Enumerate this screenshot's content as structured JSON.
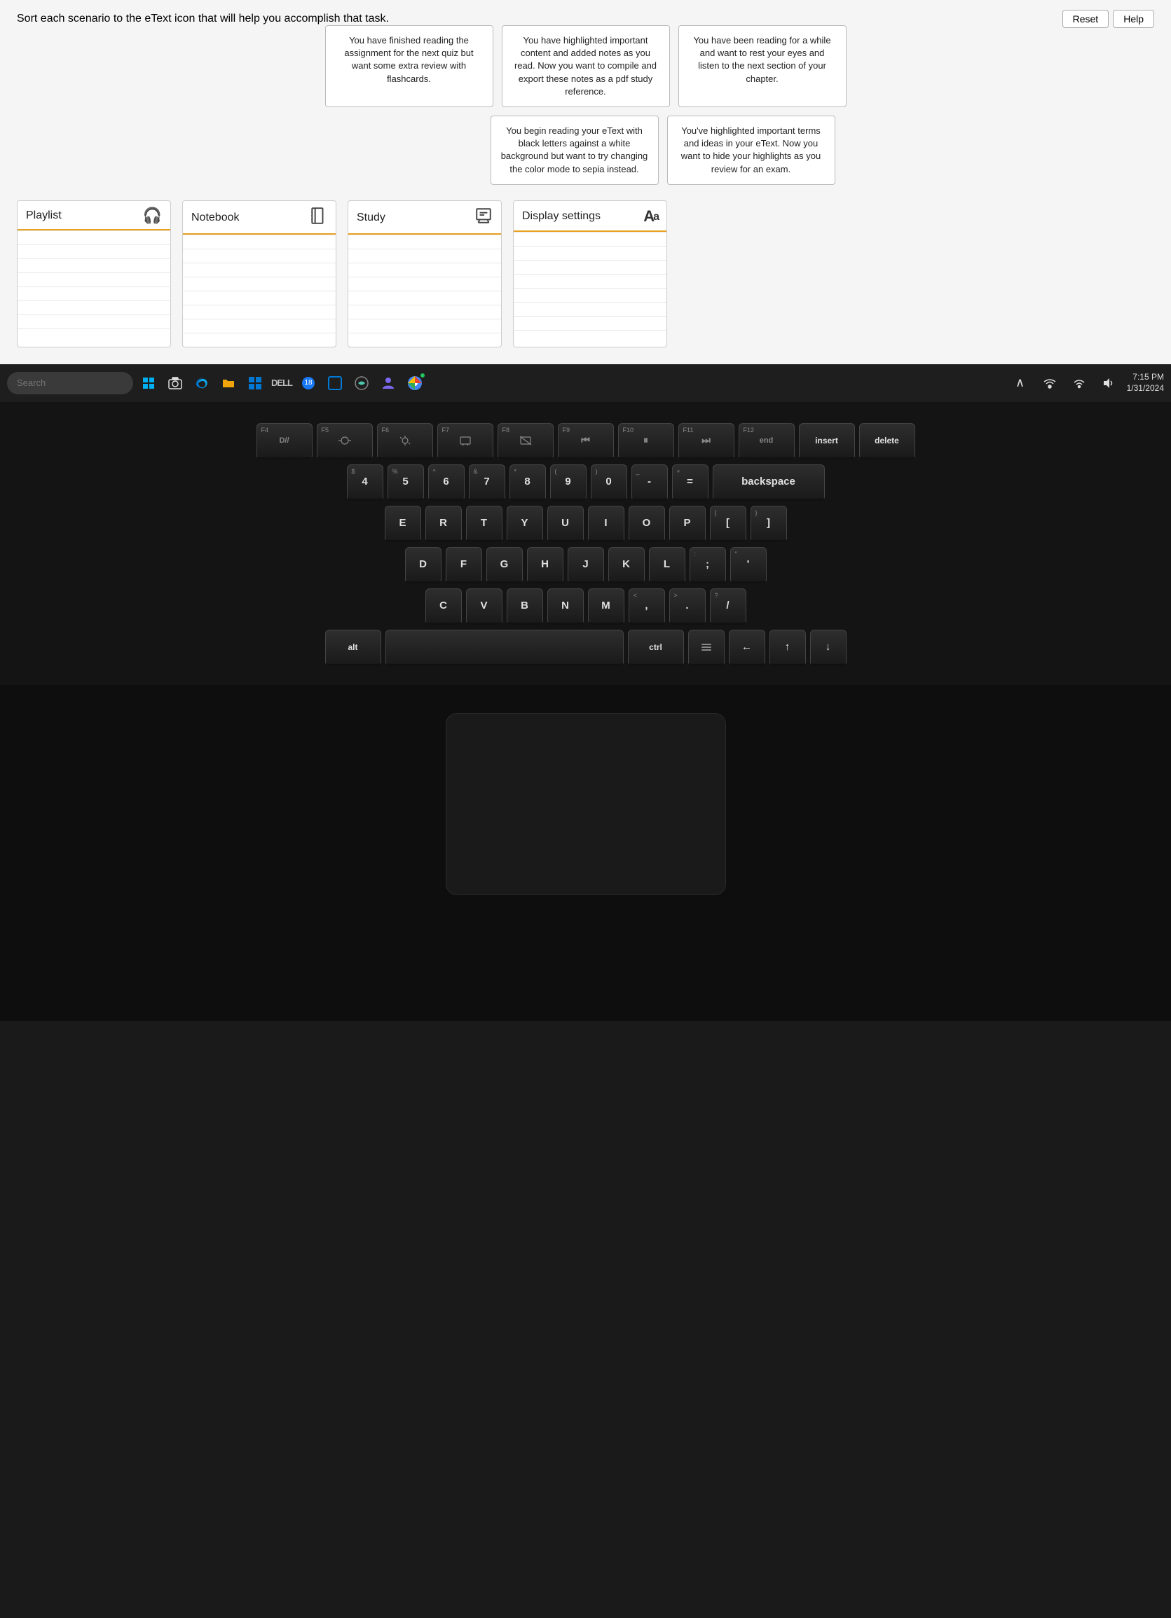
{
  "instruction": "Sort each scenario to the eText icon that will help you accomplish that task.",
  "buttons": {
    "reset": "Reset",
    "help": "Help"
  },
  "scenarios": {
    "row1": [
      {
        "id": "s1",
        "text": "You have finished reading the assignment for the next quiz but want some extra review with flashcards."
      },
      {
        "id": "s2",
        "text": "You have highlighted important content and added notes as you read. Now you want to compile and export these notes as a pdf study reference."
      },
      {
        "id": "s3",
        "text": "You have been reading for a while and want to rest your eyes and listen to the next section of your chapter."
      }
    ],
    "row2": [
      {
        "id": "s4",
        "text": "You begin reading your eText with black letters against a white background but want to try changing the color mode to sepia instead."
      },
      {
        "id": "s5",
        "text": "You've highlighted important terms and ideas in your eText. Now you want to hide your highlights as you review for an exam."
      }
    ]
  },
  "drop_zones": [
    {
      "id": "dz1",
      "label": "Playlist",
      "icon": "headphones"
    },
    {
      "id": "dz2",
      "label": "Notebook",
      "icon": "notebook"
    },
    {
      "id": "dz3",
      "label": "Study",
      "icon": "study"
    },
    {
      "id": "dz4",
      "label": "Display settings",
      "icon": "aa"
    }
  ],
  "taskbar": {
    "search_placeholder": "Search",
    "time": "7:15 PM",
    "date": "1/31/2024",
    "notification_count": "18"
  },
  "keyboard": {
    "fn_row": [
      "F4",
      "F5",
      "F6",
      "F7",
      "F8",
      "F9",
      "F10",
      "F11",
      "F12",
      "insert",
      "delete"
    ],
    "num_row": [
      "4",
      "5",
      "6",
      "7",
      "8",
      "9",
      "0",
      "-",
      "="
    ],
    "row1": [
      "E",
      "R",
      "T",
      "Y",
      "U",
      "I",
      "O",
      "P"
    ],
    "row2": [
      "D",
      "F",
      "G",
      "H",
      "J",
      "K",
      "L"
    ],
    "row3": [
      "C",
      "V",
      "B",
      "N",
      "M"
    ]
  }
}
